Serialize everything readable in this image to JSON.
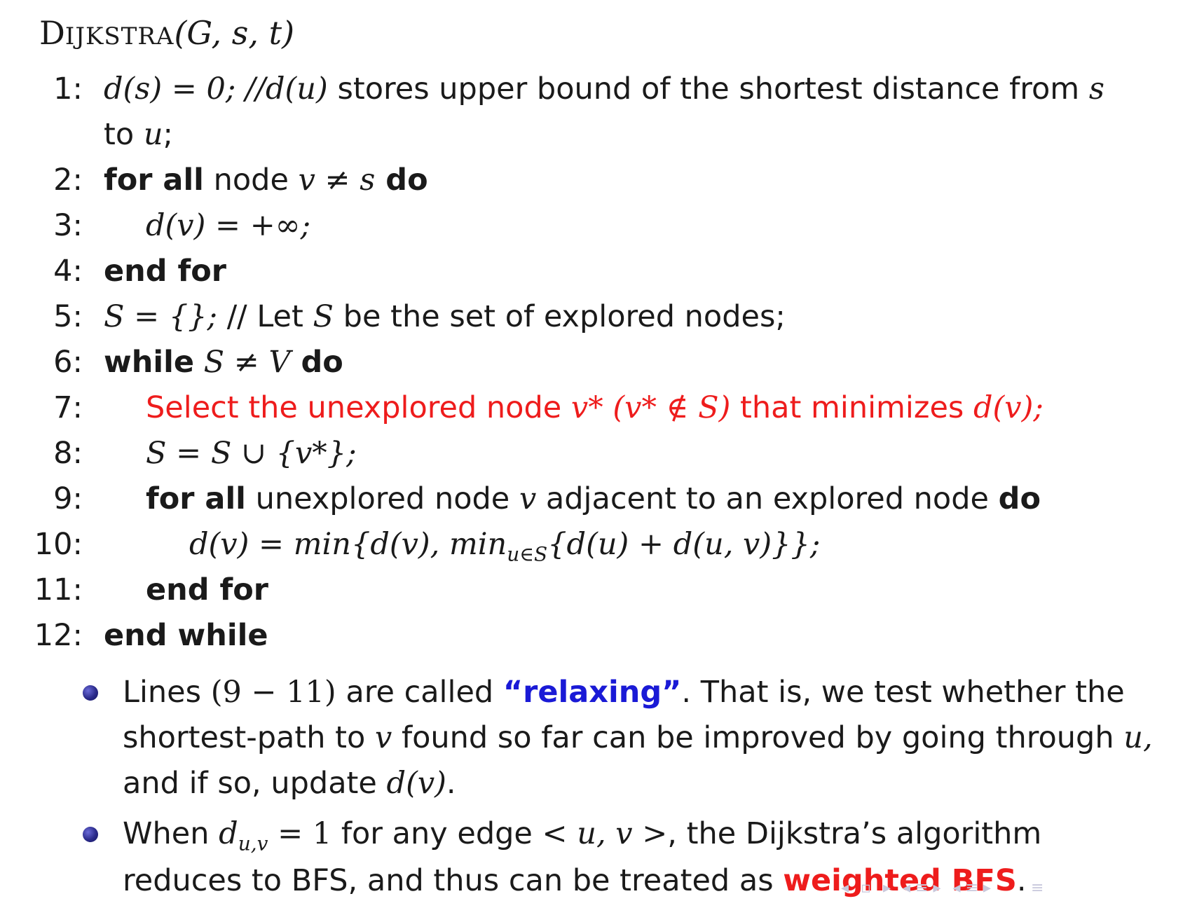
{
  "algorithm": {
    "title_first": "D",
    "title_rest": "IJKSTRA",
    "title_args": "(G, s, t)",
    "lines": [
      {
        "num": "1:",
        "l1a": "d(s) = 0; //d(u)",
        "l1b": " stores upper bound of the shortest distance from ",
        "l1c": "s",
        "l2a": "to ",
        "l2b": "u",
        "l2c": ";"
      },
      {
        "num": "2:",
        "kw1": "for all",
        "mid": " node ",
        "math": "v ≠ s",
        "kw2": " do"
      },
      {
        "num": "3:",
        "math": "d(v) = +∞;"
      },
      {
        "num": "4:",
        "kw": "end for"
      },
      {
        "num": "5:",
        "math1": "S = {};",
        "txt1": " // Let ",
        "math2": "S",
        "txt2": " be the set of explored nodes;"
      },
      {
        "num": "6:",
        "kw1": "while",
        "math": " S ≠ V",
        "kw2": " do"
      },
      {
        "num": "7:",
        "txt1": "Select the unexplored node ",
        "math1": "v*",
        "math2": " (v* ∉ S)",
        "txt2": " that minimizes ",
        "math3": "d(v);"
      },
      {
        "num": "8:",
        "math": "S = S ∪ {v*};"
      },
      {
        "num": "9:",
        "kw1": "for all",
        "txt1": " unexplored node ",
        "math": "v",
        "txt2": " adjacent to an explored node ",
        "kw2": "do"
      },
      {
        "num": "10:",
        "math": "d(v) = min{d(v), min",
        "sub": "u∈S",
        "math2": "{d(u) + d(u, v)}};"
      },
      {
        "num": "11:",
        "kw": "end for"
      },
      {
        "num": "12:",
        "kw": "end while"
      }
    ]
  },
  "bullets": [
    {
      "a": "Lines ",
      "b": "(9 − 11)",
      "c": " are called ",
      "d": "“relaxing”",
      "e": ". That is, we test whether the",
      "f": "shortest-path to ",
      "g": "v",
      "h": " found so far can be improved by going through ",
      "i": "u,",
      "j": "and if so, update ",
      "k": "d(v)",
      "l": "."
    },
    {
      "a": "When ",
      "b": "d",
      "b_sub": "u,v",
      "c": " = 1",
      "d": " for any edge ",
      "e": "< u, v >",
      "f": ", the Dijkstra’s algorithm",
      "g": "reduces to BFS, and thus can be treated as ",
      "h": "weighted BFS",
      "i": "."
    }
  ],
  "colors": {
    "highlight_red": "#ee1c1c",
    "highlight_blue": "#1a1ad6",
    "bullet": "#2a2a8a"
  },
  "nav_icons": [
    "nav-left-arrow-icon",
    "nav-frame-icon",
    "nav-right-arrow-icon",
    "nav-section-icon",
    "nav-menu-icon"
  ]
}
